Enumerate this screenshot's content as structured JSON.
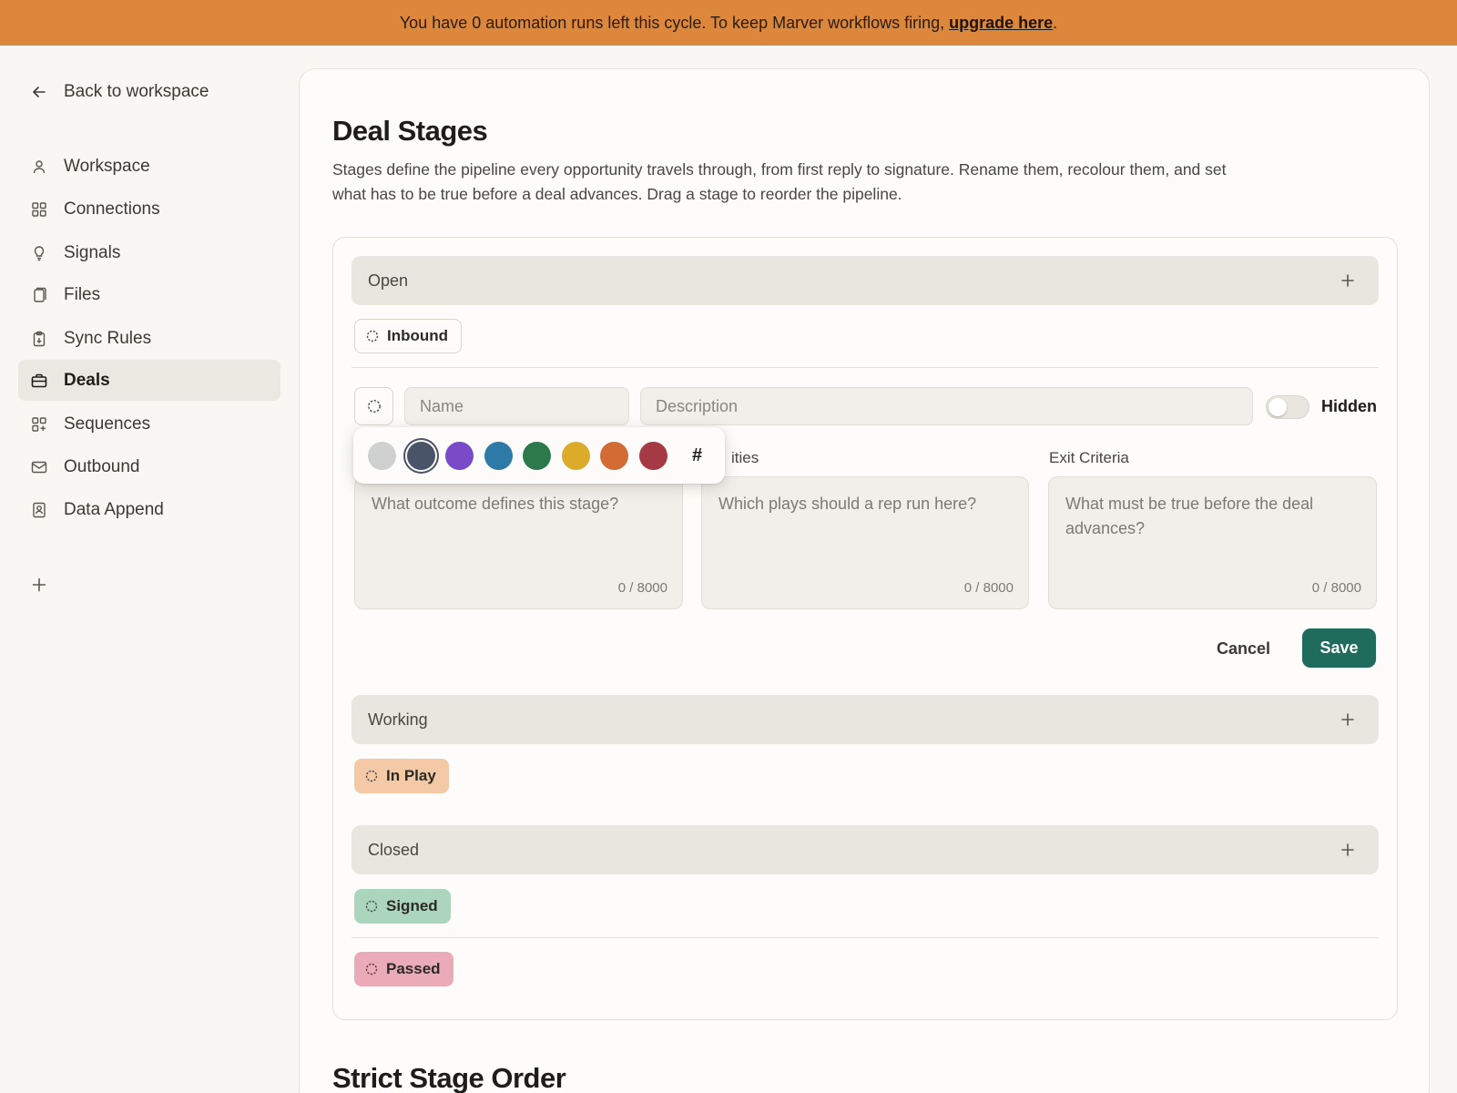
{
  "banner": {
    "text": "You have 0 automation runs left this cycle. To keep Marver workflows firing,",
    "link": "upgrade here",
    "suffix": ".",
    "color": "#dc873c"
  },
  "sidebar": {
    "back_label": "Back to workspace",
    "items": [
      {
        "label": "Workspace",
        "icon": "user-icon"
      },
      {
        "label": "Connections",
        "icon": "grid-icon"
      },
      {
        "label": "Signals",
        "icon": "lightbulb-icon"
      },
      {
        "label": "Files",
        "icon": "files-icon"
      },
      {
        "label": "Sync Rules",
        "icon": "clipboard-icon"
      },
      {
        "label": "Deals",
        "icon": "briefcase-icon",
        "active": true
      },
      {
        "label": "Sequences",
        "icon": "sequence-grid-icon"
      },
      {
        "label": "Outbound",
        "icon": "mail-icon"
      },
      {
        "label": "Data Append",
        "icon": "contact-icon"
      }
    ]
  },
  "page": {
    "title": "Deal Stages",
    "description": "Stages define the pipeline every opportunity travels through, from first reply to signature. Rename them, recolour them, and set what has to be true before a deal advances. Drag a stage to reorder the pipeline.",
    "next_section": "Strict Stage Order"
  },
  "groups": [
    {
      "name": "Open",
      "stages": [
        {
          "label": "Inbound",
          "color": "#ffffff"
        }
      ]
    },
    {
      "name": "Working",
      "stages": [
        {
          "label": "In Play",
          "color": "#f3c9a6"
        }
      ]
    },
    {
      "name": "Closed",
      "stages": [
        {
          "label": "Signed",
          "color": "#acd5bd"
        },
        {
          "label": "Passed",
          "color": "#ebaab7"
        }
      ]
    }
  ],
  "editor": {
    "name_placeholder": "Name",
    "description_placeholder": "Description",
    "hidden_label": "Hidden",
    "hidden": false,
    "fields": [
      {
        "label": "",
        "placeholder": "What outcome defines this stage?",
        "counter": "0 / 8000"
      },
      {
        "label": "ities",
        "placeholder": "Which plays should a rep run here?",
        "counter": "0 / 8000"
      },
      {
        "label": "Exit Criteria",
        "placeholder": "What must be true before the deal advances?",
        "counter": "0 / 8000"
      }
    ],
    "cancel_label": "Cancel",
    "save_label": "Save",
    "save_color": "#1f6b5c"
  },
  "palette": {
    "colors": [
      "#cfd1d1",
      "#4a5468",
      "#7a4bc9",
      "#2c7aa5",
      "#2c7a4b",
      "#ddab2a",
      "#d36b35",
      "#a53a44"
    ],
    "selected": 1,
    "custom_label": "#"
  }
}
